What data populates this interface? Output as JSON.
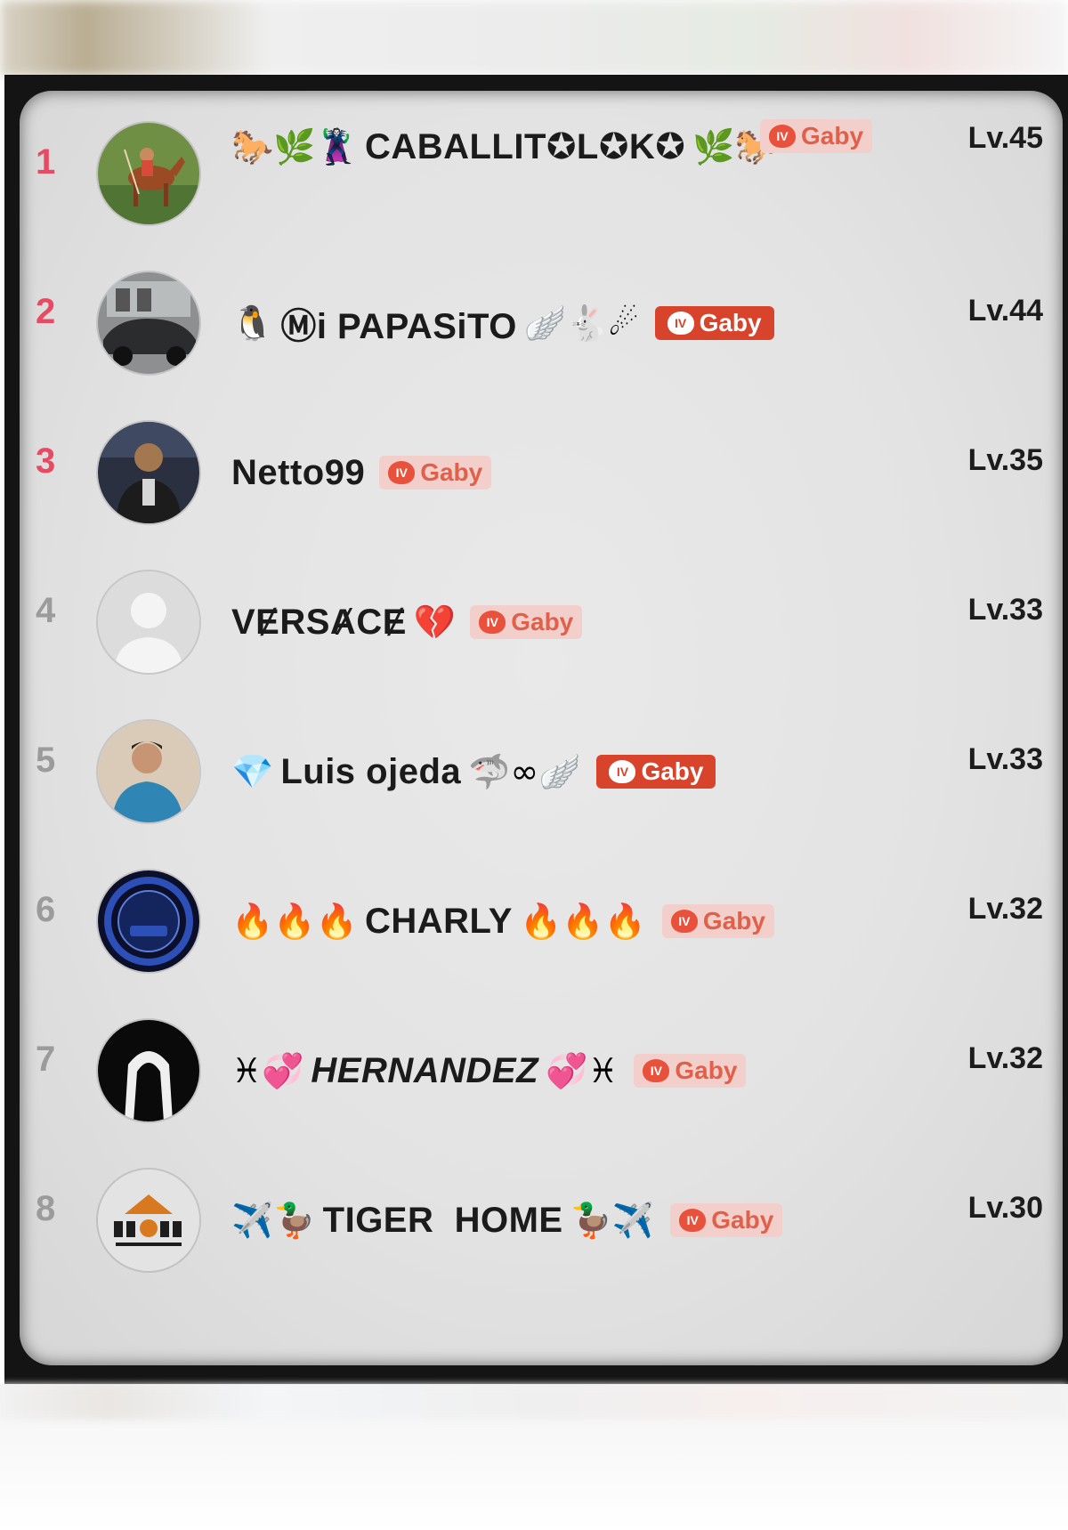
{
  "leaderboard": {
    "rows": [
      {
        "rank": "1",
        "name_prefix": "🐎🌿🦹",
        "name": "CABALLIT✪L✪K✪",
        "name_suffix": "🌿🐎",
        "badge": "Gaby",
        "badge_style": "light",
        "level": "Lv.45",
        "avatar": "horse-rider-photo"
      },
      {
        "rank": "2",
        "name_prefix": "🐧",
        "name": "Ⓜi PAPASiTO",
        "name_suffix": "🪽🐇☄",
        "badge": "Gaby",
        "badge_style": "strong",
        "level": "Lv.44",
        "avatar": "car-photo"
      },
      {
        "rank": "3",
        "name_prefix": "",
        "name": "Netto99",
        "name_suffix": "",
        "badge": "Gaby",
        "badge_style": "light",
        "level": "Lv.35",
        "avatar": "person-photo"
      },
      {
        "rank": "4",
        "name_prefix": "",
        "name": "VɆRSȺCɆ",
        "name_suffix": "💔",
        "badge": "Gaby",
        "badge_style": "light",
        "level": "Lv.33",
        "avatar": "default-avatar"
      },
      {
        "rank": "5",
        "name_prefix": "💎",
        "name": "Luis ojeda",
        "name_suffix": "🦈∞🪽",
        "badge": "Gaby",
        "badge_style": "strong",
        "level": "Lv.33",
        "avatar": "person-blue-shirt-photo"
      },
      {
        "rank": "6",
        "name_prefix": "🔥🔥🔥",
        "name": "CHARLY",
        "name_suffix": "🔥🔥🔥",
        "badge": "Gaby",
        "badge_style": "light",
        "level": "Lv.32",
        "avatar": "charly-logo"
      },
      {
        "rank": "7",
        "name_prefix": "♓💞",
        "name": "HERNANDEZ",
        "name_suffix": "💞♓",
        "badge": "Gaby",
        "badge_style": "light",
        "level": "Lv.32",
        "avatar": "hooded-figure"
      },
      {
        "rank": "8",
        "name_prefix": "✈️🦆",
        "name": "TIGER  HOME",
        "name_suffix": "🦆✈️",
        "badge": "Gaby",
        "badge_style": "light",
        "level": "Lv.30",
        "avatar": "tiger-logo"
      }
    ],
    "rank_top_color": "#e84a64",
    "rank_color": "#9b9b9b",
    "badge_icon_text": "IV"
  }
}
